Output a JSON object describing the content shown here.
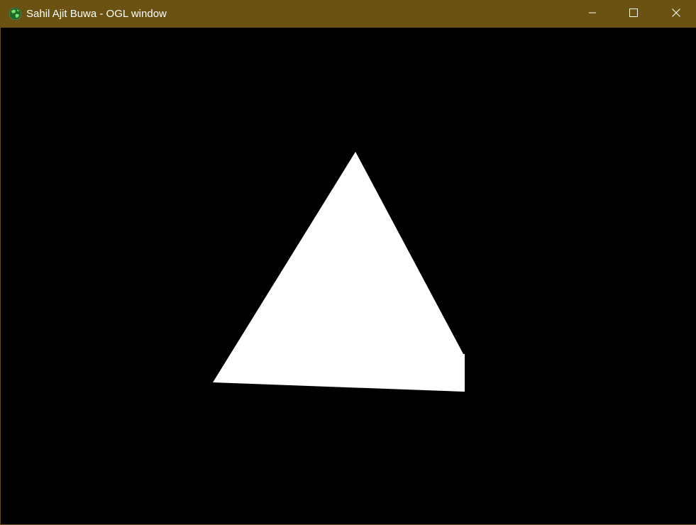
{
  "window": {
    "title": "Sahil Ajit Buwa - OGL window",
    "titlebar_color": "#6b5212",
    "icon": "globe-icon",
    "controls": {
      "minimize": "minimize-icon",
      "maximize": "maximize-icon",
      "close": "close-icon"
    }
  },
  "viewport": {
    "background_color": "#000000",
    "shape": "pyramid",
    "shape_color": "#ffffff"
  }
}
